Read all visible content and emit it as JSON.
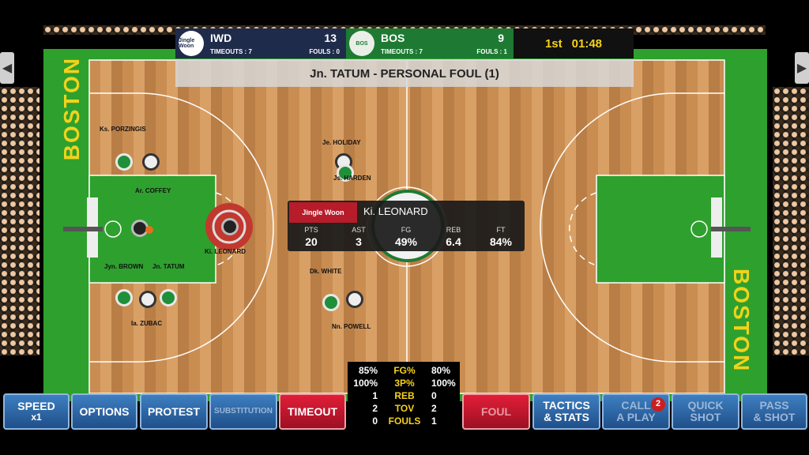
{
  "scoreboard": {
    "home": {
      "abbr": "IWD",
      "score": "13",
      "timeouts": "TIMEOUTS : 7",
      "fouls": "FOULS : 0",
      "logo_text": "Jingle Woon"
    },
    "away": {
      "abbr": "BOS",
      "score": "9",
      "timeouts": "TIMEOUTS : 7",
      "fouls": "FOULS : 1",
      "logo_text": "BOS"
    },
    "period": "1st",
    "clock": "01:48"
  },
  "event_banner": "Jn. TATUM - PERSONAL FOUL (1)",
  "court_text": {
    "boston_left": "BOSTON",
    "boston_right": "BOSTON"
  },
  "players": [
    {
      "name": "Ks. PORZINGIS"
    },
    {
      "name": "Ar. COFFEY"
    },
    {
      "name": "Jyn. BROWN"
    },
    {
      "name": "Jn. TATUM"
    },
    {
      "name": "Ki. LEONARD"
    },
    {
      "name": "Ia. ZUBAC"
    },
    {
      "name": "Je. HOLIDAY"
    },
    {
      "name": "Js. HARDEN"
    },
    {
      "name": "Dk. WHITE"
    },
    {
      "name": "Nn. POWELL"
    }
  ],
  "player_card": {
    "logo_text": "Jingle Woon",
    "name": "Ki. LEONARD",
    "labels": [
      "PTS",
      "AST",
      "FG",
      "REB",
      "FT"
    ],
    "values": [
      "20",
      "3",
      "49%",
      "6.4",
      "84%"
    ]
  },
  "team_stats": [
    {
      "left": "85%",
      "label": "FG%",
      "right": "80%"
    },
    {
      "left": "100%",
      "label": "3P%",
      "right": "100%"
    },
    {
      "left": "1",
      "label": "REB",
      "right": "0"
    },
    {
      "left": "2",
      "label": "TOV",
      "right": "2"
    },
    {
      "left": "0",
      "label": "FOULS",
      "right": "1"
    }
  ],
  "buttons": {
    "speed": {
      "label": "SPEED",
      "sub": "x1"
    },
    "options": "OPTIONS",
    "protest": "PROTEST",
    "substitution": "SUBSTITUTION",
    "timeout": "TIMEOUT",
    "foul": "FOUL",
    "tactics": {
      "line1": "TACTICS",
      "line2": "& STATS"
    },
    "call_play": {
      "line1": "CALL",
      "line2": "A PLAY",
      "badge": "2"
    },
    "quick_shot": {
      "line1": "QUICK",
      "line2": "SHOT"
    },
    "pass_shot": {
      "line1": "PASS",
      "line2": "& SHOT"
    }
  },
  "nav": {
    "left": "◀",
    "right": "▶"
  },
  "colors": {
    "court_green": "#2ea02e",
    "home_navy": "#1f2b4a",
    "away_green": "#1e7a33",
    "accent_yellow": "#f5d21a",
    "button_blue": "#2f6aa8",
    "button_red": "#c8182f"
  }
}
